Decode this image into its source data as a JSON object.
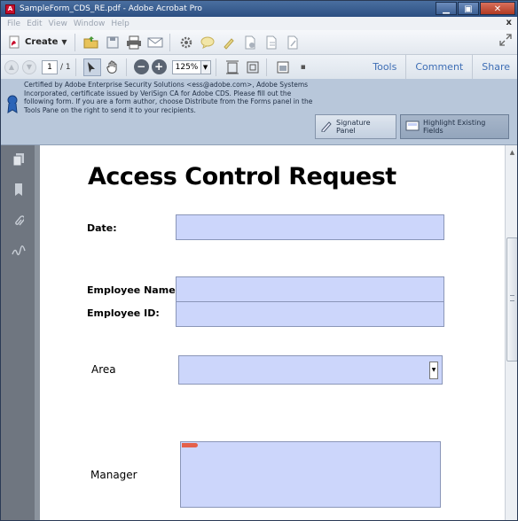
{
  "window": {
    "title": "SampleForm_CDS_RE.pdf - Adobe Acrobat Pro",
    "app_icon_glyph": "A",
    "min": "▁",
    "max": "▣",
    "close": "✕"
  },
  "menu": {
    "items": [
      "File",
      "Edit",
      "View",
      "Window",
      "Help"
    ],
    "close": "x"
  },
  "toolbar1": {
    "create_label": "Create",
    "create_arrow": "▼"
  },
  "toolbar2": {
    "page_current": "1",
    "page_total": "/ 1",
    "zoom_value": "125%",
    "zoom_out": "−",
    "zoom_in": "+",
    "tabs": [
      "Tools",
      "Comment",
      "Share"
    ]
  },
  "notification": {
    "text": "Certified by Adobe Enterprise Security Solutions <ess@adobe.com>, Adobe Systems Incorporated, certificate issued by VeriSign CA for Adobe CDS. Please fill out the following form. If you are a form author, choose Distribute from the Forms panel in the Tools Pane on the right to send it to your recipients.",
    "signature_panel": "Signature Panel",
    "highlight_fields": "Highlight Existing Fields"
  },
  "form": {
    "title": "Access Control Request",
    "date_label": "Date:",
    "employee_name_label": "Employee Name:",
    "employee_id_label": "Employee ID:",
    "area_label": "Area",
    "manager_label": "Manager",
    "field_color": "#ccd6fb"
  },
  "icons": {
    "create": "create-pdf-icon",
    "open": "open-folder-icon",
    "save": "save-icon",
    "print": "print-icon",
    "email": "email-icon",
    "settings": "gear-icon",
    "comment": "comment-bubble-icon",
    "highlight": "highlight-icon",
    "doc1": "document-icon",
    "doc2": "document-icon",
    "doc3": "document-icon",
    "expand": "expand-icon"
  }
}
